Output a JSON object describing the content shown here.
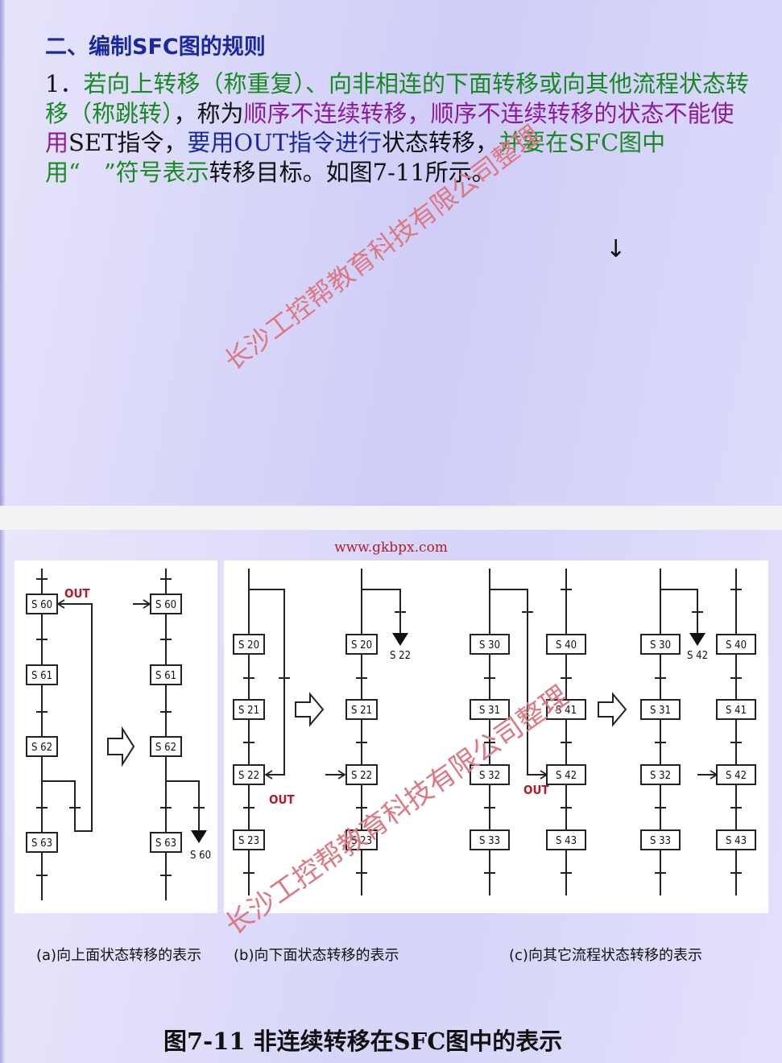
{
  "slide1": {
    "heading": "二、编制SFC图的规则",
    "paragraph": [
      {
        "text": "1．",
        "color": "#111111"
      },
      {
        "text": "若向上转移（称重复）、向非相连的下面转移或向其他流程状态转移（称跳转）",
        "color": "#178a23"
      },
      {
        "text": "，称为",
        "color": "#111111"
      },
      {
        "text": "顺序不连续转移，顺序不连续转移的状态不能使用",
        "color": "#8a1b9c"
      },
      {
        "text": "SET指令，",
        "color": "#111111"
      },
      {
        "text": "要用OUT指令进行",
        "color": "#1a2a9c"
      },
      {
        "text": "状态转移，",
        "color": "#111111"
      },
      {
        "text": "并要在SFC图中用“　”符号表示",
        "color": "#178a23"
      },
      {
        "text": "转移目标。如图7-11所示。",
        "color": "#111111"
      }
    ],
    "arrow_glyph": "↓"
  },
  "watermark": {
    "text": "长沙工控帮教育科技有限公司整理",
    "color": "#dc7882"
  },
  "slide2": {
    "url": "www.gkbpx.com",
    "out_label": "OUT",
    "diagram_a": {
      "left": {
        "steps": [
          "S 60",
          "S 61",
          "S 62",
          "S 63"
        ]
      },
      "right": {
        "steps": [
          "S 60",
          "S 61",
          "S 62",
          "S 63"
        ],
        "target": "S 60"
      }
    },
    "diagram_b": {
      "left": {
        "steps": [
          "S 20",
          "S 21",
          "S 22",
          "S 23"
        ]
      },
      "right": {
        "steps": [
          "S 20",
          "S 21",
          "S 22",
          "S 23"
        ],
        "target": "S 22"
      }
    },
    "diagram_c": {
      "left_a": {
        "steps": [
          "S 30",
          "S 31",
          "S 32",
          "S 33"
        ]
      },
      "left_b": {
        "steps": [
          "S 40",
          "S 41",
          "S 42",
          "S 43"
        ]
      },
      "right_a": {
        "steps": [
          "S 30",
          "S 31",
          "S 32",
          "S 33"
        ],
        "target": "S 42"
      },
      "right_b": {
        "steps": [
          "S 40",
          "S 41",
          "S 42",
          "S 43"
        ]
      }
    },
    "captions": {
      "a": "(a)向上面状态转移的表示",
      "b": "(b)向下面状态转移的表示",
      "c": "(c)向其它流程状态转移的表示"
    },
    "figure_title": "图7-11 非连续转移在SFC图中的表示"
  }
}
